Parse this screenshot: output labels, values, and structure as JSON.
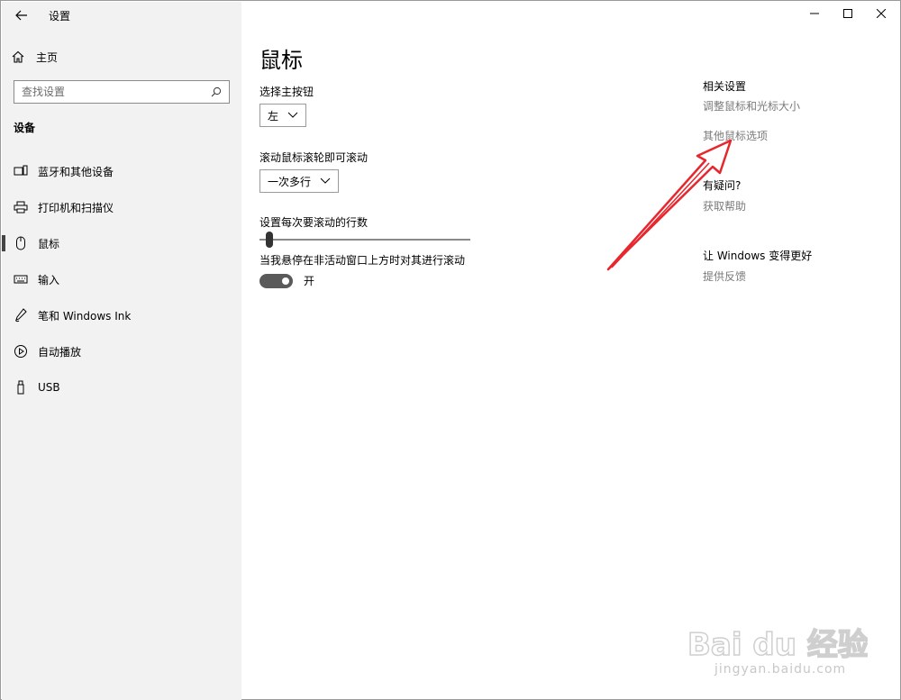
{
  "window": {
    "app_title": "设置",
    "controls": [
      "minimize",
      "maximize",
      "close"
    ]
  },
  "sidebar": {
    "home_label": "主页",
    "search_placeholder": "查找设置",
    "section_title": "设备",
    "items": [
      {
        "label": "蓝牙和其他设备",
        "icon": "bluetooth-devices-icon"
      },
      {
        "label": "打印机和扫描仪",
        "icon": "printer-icon"
      },
      {
        "label": "鼠标",
        "icon": "mouse-icon",
        "active": true
      },
      {
        "label": "输入",
        "icon": "keyboard-icon"
      },
      {
        "label": "笔和 Windows Ink",
        "icon": "pen-icon"
      },
      {
        "label": "自动播放",
        "icon": "autoplay-icon"
      },
      {
        "label": "USB",
        "icon": "usb-icon"
      }
    ]
  },
  "main": {
    "title": "鼠标",
    "primary_button": {
      "label": "选择主按钮",
      "value": "左"
    },
    "scroll_mode": {
      "label": "滚动鼠标滚轮即可滚动",
      "value": "一次多行"
    },
    "lines_slider": {
      "label": "设置每次要滚动的行数",
      "value_fraction": 0.03
    },
    "inactive_scroll": {
      "label": "当我悬停在非活动窗口上方时对其进行滚动",
      "state": "开",
      "on": true
    }
  },
  "related": {
    "heading": "相关设置",
    "links": [
      "调整鼠标和光标大小",
      "其他鼠标选项"
    ],
    "help_heading": "有疑问?",
    "help_link": "获取帮助",
    "feedback_heading": "让 Windows 变得更好",
    "feedback_link": "提供反馈"
  },
  "colors": {
    "sidebar_bg": "#f2f2f2",
    "arrow": "#e8262d",
    "link_gray": "#7a7a7a",
    "toggle_on": "#5a5a5a"
  },
  "watermark": {
    "brand": "Bai du 经验",
    "url": "jingyan.baidu.com"
  }
}
